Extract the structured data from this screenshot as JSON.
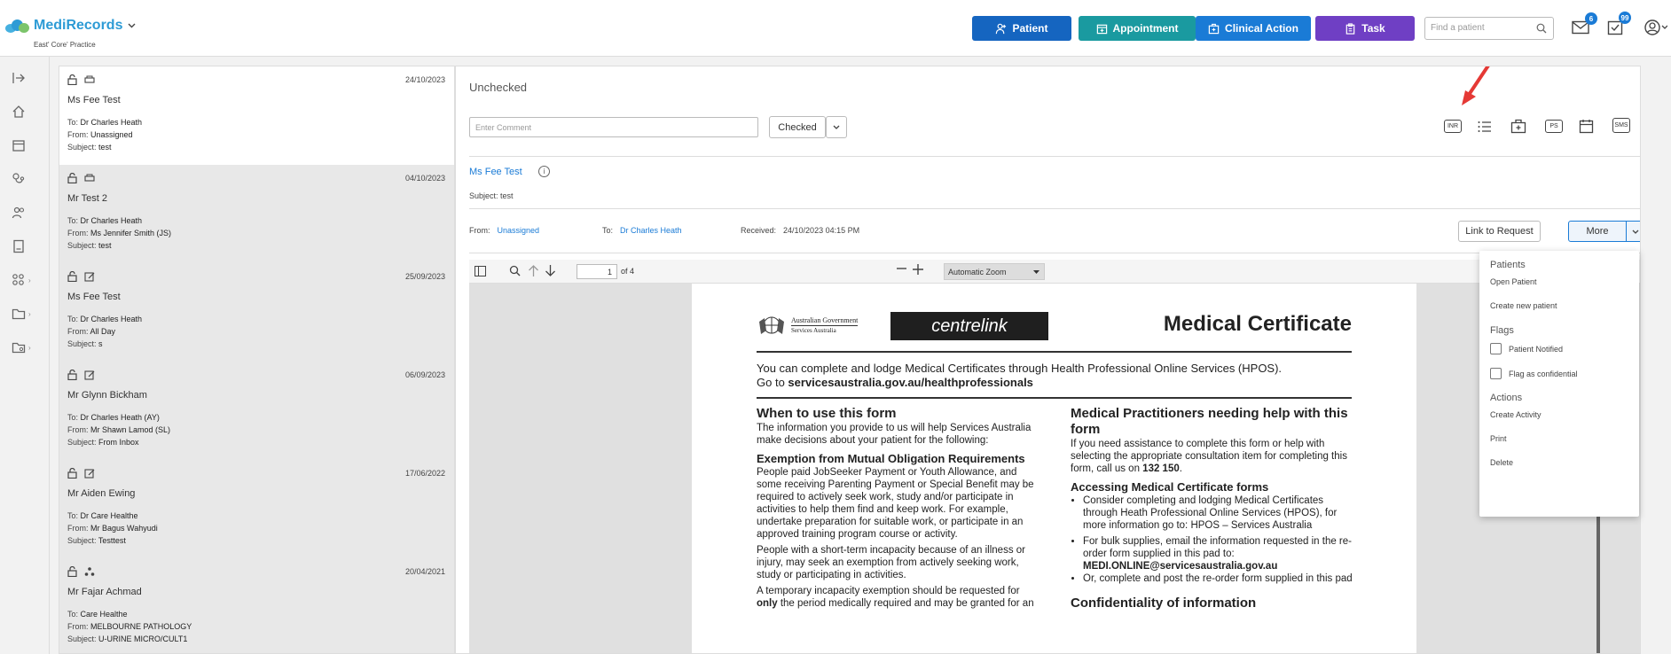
{
  "app": {
    "brand_part1": "Medi",
    "brand_part2": "Records",
    "practice": "East' Core' Practice"
  },
  "header": {
    "buttons": [
      {
        "label": "Patient",
        "color": "#1565c0"
      },
      {
        "label": "Appointment",
        "color": "#1a9aa0"
      },
      {
        "label": "Clinical Action",
        "color": "#1a7bd6"
      },
      {
        "label": "Task",
        "color": "#6f3fc4"
      }
    ],
    "search_placeholder": "Find a patient",
    "mail_badge": "6",
    "task_badge": "99"
  },
  "inbox": [
    {
      "date": "24/10/2023",
      "name": "Ms Fee Test",
      "to": "Dr Charles Heath",
      "from": "Unassigned",
      "subject": "test"
    },
    {
      "date": "04/10/2023",
      "name": "Mr Test 2",
      "to": "Dr Charles Heath",
      "from": "Ms Jennifer Smith (JS)",
      "subject": "test"
    },
    {
      "date": "25/09/2023",
      "name": "Ms Fee Test",
      "to": "Dr Charles Heath",
      "from": "All Day",
      "subject": "s"
    },
    {
      "date": "06/09/2023",
      "name": "Mr Glynn Bickham",
      "to": "Dr Charles Heath (AY)",
      "from": "Mr Shawn Lamod (SL)",
      "subject": "From Inbox"
    },
    {
      "date": "17/06/2022",
      "name": "Mr Aiden Ewing",
      "to": "Dr Care Healthe",
      "from": "Mr Bagus Wahyudi",
      "subject": "Testtest"
    },
    {
      "date": "20/04/2021",
      "name": "Mr Fajar Achmad",
      "to": "Care Healthe",
      "from": "MELBOURNE PATHOLOGY",
      "subject": "U-URINE MICRO/CULT1"
    }
  ],
  "labels": {
    "to": "To:",
    "from": "From:",
    "subject": "Subject:",
    "received": "Received:"
  },
  "detail": {
    "status": "Unchecked",
    "comment_placeholder": "Enter Comment",
    "checked_label": "Checked",
    "tool_tags": [
      "INR",
      "PS",
      "SMS"
    ],
    "patient_name": "Ms Fee Test",
    "subject": "test",
    "from": "Unassigned",
    "to": "Dr Charles Heath",
    "received": "24/10/2023 04:15 PM",
    "link_button": "Link to Request",
    "more_button": "More"
  },
  "pdf": {
    "page": "1",
    "of": "of 4",
    "zoom": "Automatic Zoom",
    "gov_line1": "Australian Government",
    "gov_line2": "Services Australia",
    "centrelink": "centrelink",
    "title": "Medical Certificate",
    "intro1": "You can complete and lodge Medical Certificates through Health Professional Online Services (HPOS).",
    "intro2_prefix": "Go to ",
    "intro2_link": "servicesaustralia.gov.au/healthprofessionals",
    "left_h1": "When to use this form",
    "left_p1": "The information you provide to us will help Services Australia make decisions about your patient for the following:",
    "left_h2": "Exemption from Mutual Obligation Requirements",
    "left_p2": "People paid JobSeeker Payment or Youth Allowance, and some receiving Parenting Payment or Special Benefit may be required to actively seek work, study and/or participate in activities to help them find and keep work. For example, undertake preparation for suitable work, or participate in an approved training program course or activity.",
    "left_p3": "People with a short-term incapacity because of an illness or injury, may seek an exemption from actively seeking work, study or participating in activities.",
    "left_p4_a": "A temporary incapacity exemption should be requested for ",
    "left_p4_b": "only",
    "left_p4_c": " the period medically required and may be granted for an",
    "right_h1": "Medical Practitioners needing help with this form",
    "right_p1_a": "If you need assistance to complete this form or help with selecting the appropriate consultation item for completing this form, call us on ",
    "right_p1_b": "132 150",
    "right_p1_c": ".",
    "right_h2": "Accessing Medical Certificate forms",
    "right_b1": "Consider completing and lodging Medical Certificates through Heath Professional Online Services (HPOS), for more information go to: HPOS – Services Australia",
    "right_b2_a": "For bulk supplies, email the information requested in the re-order form supplied in this pad to:",
    "right_b2_b": "MEDI.ONLINE@servicesaustralia.gov.au",
    "right_b3": "Or, complete and post the re-order form supplied in this pad",
    "right_h3": "Confidentiality of information"
  },
  "more_menu": {
    "patients_h": "Patients",
    "open_patient": "Open Patient",
    "create_patient": "Create new patient",
    "flags_h": "Flags",
    "patient_notified": "Patient Notified",
    "flag_confidential": "Flag as confidential",
    "actions_h": "Actions",
    "create_activity": "Create Activity",
    "print": "Print",
    "delete": "Delete"
  }
}
